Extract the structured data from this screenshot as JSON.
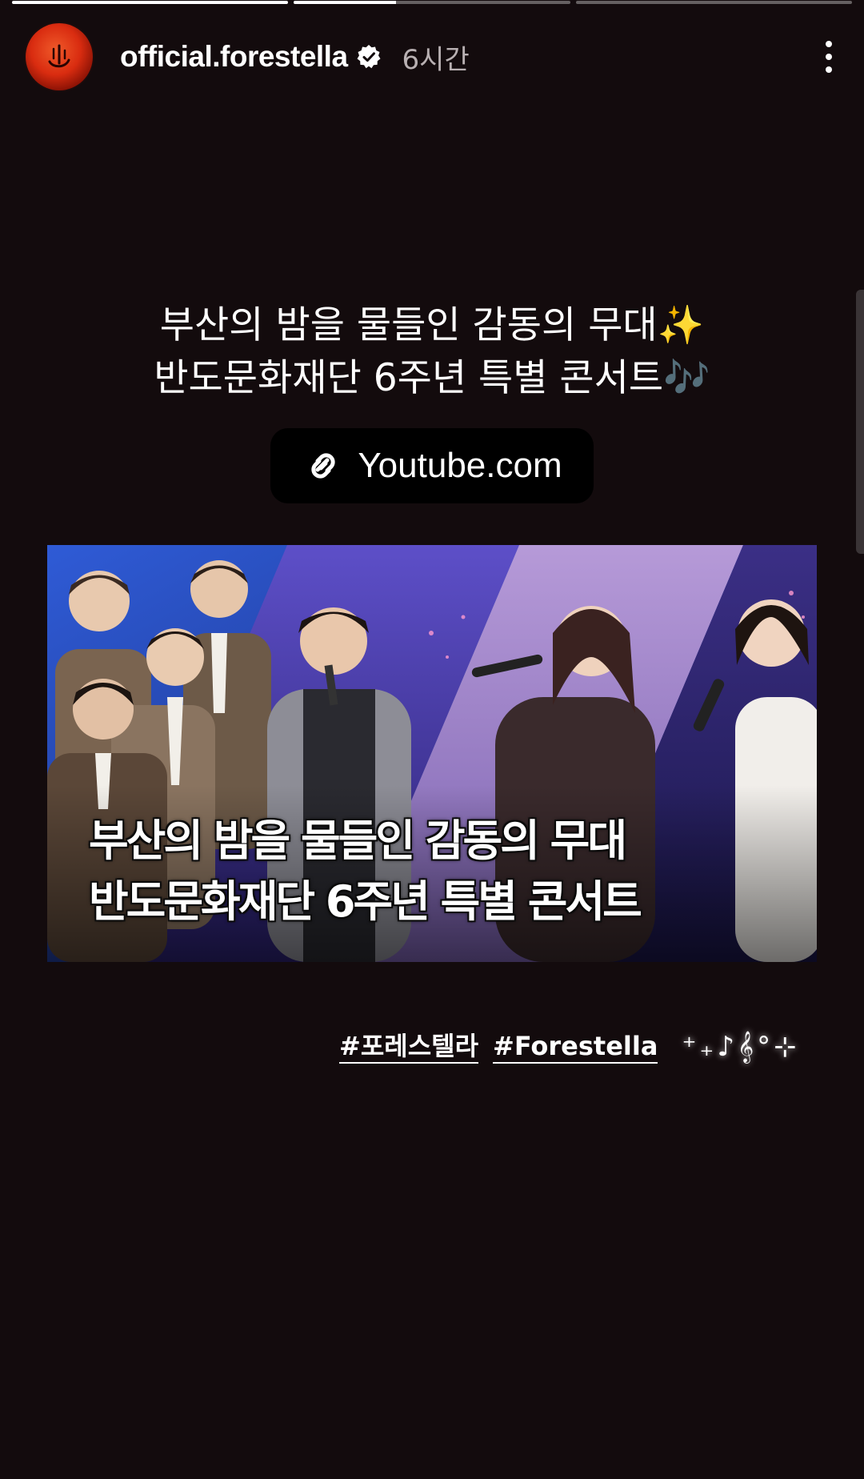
{
  "story": {
    "progress": [
      {
        "fill": 1.0
      },
      {
        "fill": 0.37
      },
      {
        "fill": 0.0
      }
    ]
  },
  "header": {
    "username": "official.forestella",
    "time": "6시간",
    "verified_icon": "verified-badge-icon",
    "more_icon": "more-vertical-icon"
  },
  "caption": {
    "line1": "부산의 밤을 물들인 감동의 무대✨",
    "line2": "반도문화재단 6주년 특별 콘서트🎶"
  },
  "link": {
    "icon": "link-icon",
    "label": "Youtube.com"
  },
  "thumbnail": {
    "title_line1": "부산의 밤을 물들인 감동의 무대",
    "title_line2": "반도문화재단 6주년 특별 콘서트"
  },
  "hashtags": {
    "tag1": "#포레스텔라",
    "tag2": "#Forestella",
    "decoration": "⁺₊♪𝄞°⊹"
  },
  "colors": {
    "background": "#130b0d",
    "avatar": "#d92c10",
    "link_sticker_bg": "#000000"
  }
}
